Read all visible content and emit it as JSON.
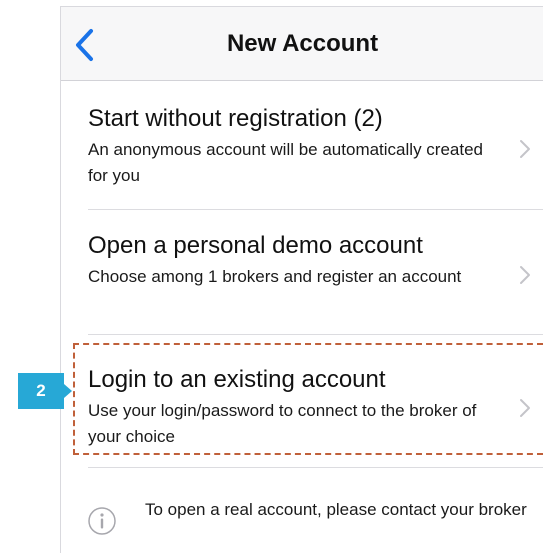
{
  "navbar": {
    "back_icon": "chevron-left-icon",
    "title": "New Account",
    "accent_color": "#1a73e8"
  },
  "options": [
    {
      "title": "Start without registration (2)",
      "subtitle": "An anonymous account will be automatically created for you",
      "icon": "chevron-right-icon"
    },
    {
      "title": "Open a personal demo account",
      "subtitle": "Choose among 1 brokers and register an account",
      "icon": "chevron-right-icon"
    },
    {
      "title": "Login to an existing account",
      "subtitle": "Use your login/password to connect to the broker of your choice",
      "icon": "chevron-right-icon"
    }
  ],
  "info": {
    "icon": "info-icon",
    "text": "To open a real account, please contact your broker"
  },
  "annotation": {
    "step_number": "2",
    "badge_color": "#27a8d6",
    "highlight_color": "#c0603a"
  }
}
